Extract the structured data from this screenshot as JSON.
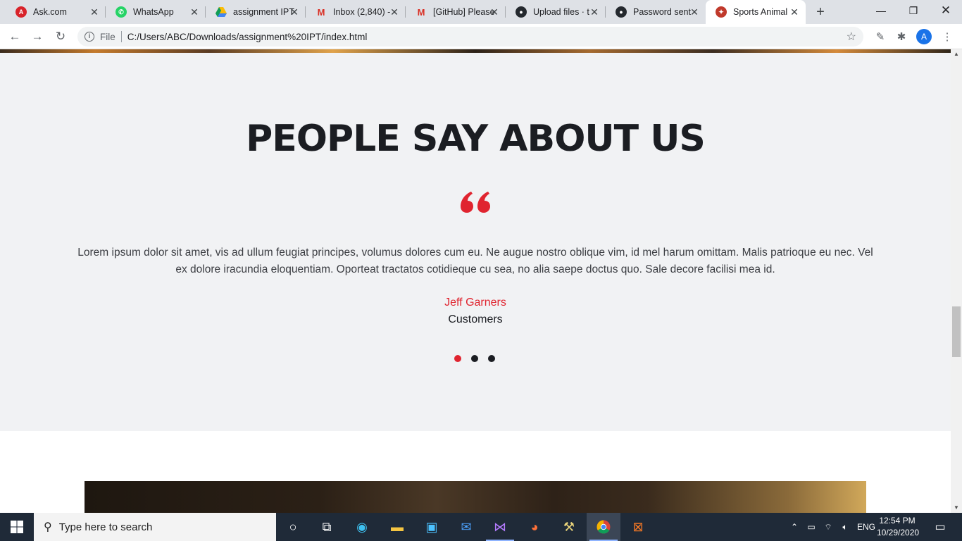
{
  "browser": {
    "tabs": [
      {
        "label": "Ask.com",
        "icon": "ask-icon",
        "color": "#d8232a"
      },
      {
        "label": "WhatsApp",
        "icon": "whatsapp-icon",
        "color": "#25d366"
      },
      {
        "label": "assignment IPT",
        "icon": "google-drive-icon",
        "color": "#fbbc04"
      },
      {
        "label": "Inbox (2,840) -",
        "icon": "gmail-icon",
        "color": "#d93025"
      },
      {
        "label": "[GitHub] Please",
        "icon": "gmail-icon",
        "color": "#d93025"
      },
      {
        "label": "Upload files · t",
        "icon": "github-icon",
        "color": "#24292e"
      },
      {
        "label": "Password sent",
        "icon": "github-icon",
        "color": "#24292e"
      },
      {
        "label": "Sports Animal",
        "icon": "sports-animal-icon",
        "color": "#c0392b",
        "active": true
      }
    ],
    "address": {
      "scheme_label": "File",
      "url": "C:/Users/ABC/Downloads/assignment%20IPT/index.html"
    },
    "profile_initial": "A"
  },
  "page": {
    "heading": "PEOPLE SAY ABOUT US",
    "quote_text": "Lorem ipsum dolor sit amet, vis ad ullum feugiat principes, volumus dolores cum eu. Ne augue nostro oblique vim, id mel harum omittam. Malis patrioque eu nec. Vel ex dolore iracundia eloquentiam. Oporteat tractatos cotidieque cu sea, no alia saepe doctus quo. Sale decore facilisi mea id.",
    "author": "Jeff Garners",
    "role": "Customers",
    "slider_dots": 3,
    "active_dot": 1,
    "accent_color": "#e0242f",
    "heading_color": "#1b1d22",
    "section_bg": "#f1f2f4"
  },
  "taskbar": {
    "search_placeholder": "Type here to search",
    "apps": [
      "cortana-icon",
      "task-view-icon",
      "edge-icon",
      "file-explorer-icon",
      "store-icon",
      "mail-icon",
      "visual-studio-icon",
      "firefox-icon",
      "tool-icon",
      "chrome-icon",
      "xampp-icon"
    ],
    "language": "ENG",
    "time": "12:54 PM",
    "date": "10/29/2020"
  }
}
